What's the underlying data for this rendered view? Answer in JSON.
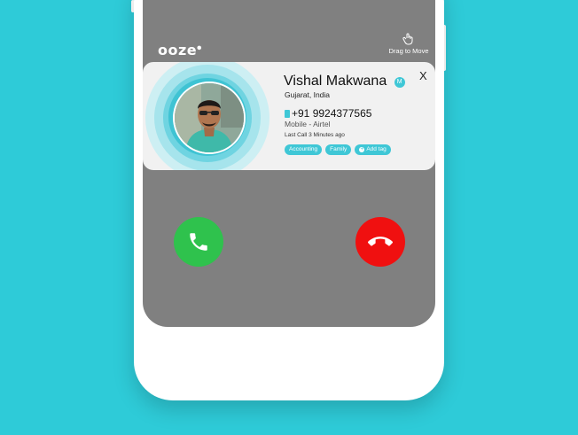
{
  "app": {
    "logo_text": "ooze",
    "drag_hint": "Drag to Move"
  },
  "caller": {
    "name": "Vishal Makwana",
    "verified_badge": "M",
    "location": "Gujarat, India",
    "phone": "+91 9924377565",
    "carrier": "Mobile - Airtel",
    "last_call": "Last Call 3 Minutes ago",
    "close_label": "X",
    "tags": [
      "Accounting",
      "Family"
    ],
    "add_tag_label": "Add tag"
  },
  "icons": {
    "logo": "ooze-logo",
    "drag": "drag-hand-icon",
    "accept": "phone-icon",
    "decline": "phone-hangup-icon"
  },
  "colors": {
    "background": "#2ecbd8",
    "accent": "#3fc7d6",
    "accept": "#2fc24d",
    "decline": "#f01010",
    "screen": "#808080"
  }
}
